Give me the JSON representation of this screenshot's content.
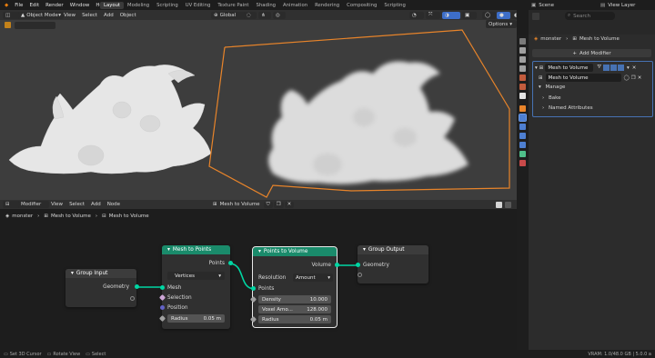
{
  "topbar": {
    "menu": [
      "File",
      "Edit",
      "Render",
      "Window",
      "Help"
    ],
    "workspaces": [
      "Layout",
      "Modeling",
      "Scripting",
      "UV Editing",
      "Texture Paint",
      "Shading",
      "Animation",
      "Rendering",
      "Compositing",
      "Scripting"
    ],
    "active_workspace": "Layout",
    "scene": "Scene",
    "view_layer": "View Layer"
  },
  "viewport": {
    "mode": "Object Mode",
    "menu": [
      "View",
      "Select",
      "Add",
      "Object"
    ],
    "orientation": "Global",
    "options": "Options"
  },
  "node_editor": {
    "editor_type": "Modifier",
    "menu": [
      "View",
      "Select",
      "Add",
      "Node"
    ],
    "node_group": "Mesh to Volume",
    "breadcrumb": [
      "monster",
      "Mesh to Volume",
      "Mesh to Volume"
    ],
    "nodes": {
      "group_input": {
        "title": "Group Input",
        "output": "Geometry"
      },
      "mesh_to_points": {
        "title": "Mesh to Points",
        "output": "Points",
        "mode": "Vertices",
        "inputs": [
          "Mesh",
          "Selection",
          "Position"
        ],
        "radius_label": "Radius",
        "radius_value": "0.05 m"
      },
      "points_to_volume": {
        "title": "Points to Volume",
        "output": "Volume",
        "resolution_label": "Resolution",
        "resolution_value": "Amount",
        "input": "Points",
        "density_label": "Density",
        "density_value": "10.000",
        "voxel_label": "Voxel Amo...",
        "voxel_value": "128.000",
        "radius_label": "Radius",
        "radius_value": "0.05 m"
      },
      "group_output": {
        "title": "Group Output",
        "input": "Geometry"
      }
    },
    "header_colors": {
      "geometry": "#1a8b6b",
      "input": "#3c3c3c"
    }
  },
  "outliner": {
    "search_placeholder": "Search"
  },
  "properties": {
    "object": "monster",
    "modifier_crumb": "Mesh to Volume",
    "add_modifier": "Add Modifier",
    "modifier_name": "Mesh to Volume",
    "node_group": "Mesh to Volume",
    "sections": [
      "Manage",
      "Bake",
      "Named Attributes"
    ]
  },
  "statusbar": {
    "items": [
      "Set 3D Cursor",
      "Rotate View",
      "Select"
    ],
    "version": "VRAM: 1.0/48.0 GB | 5.0.0 a"
  }
}
